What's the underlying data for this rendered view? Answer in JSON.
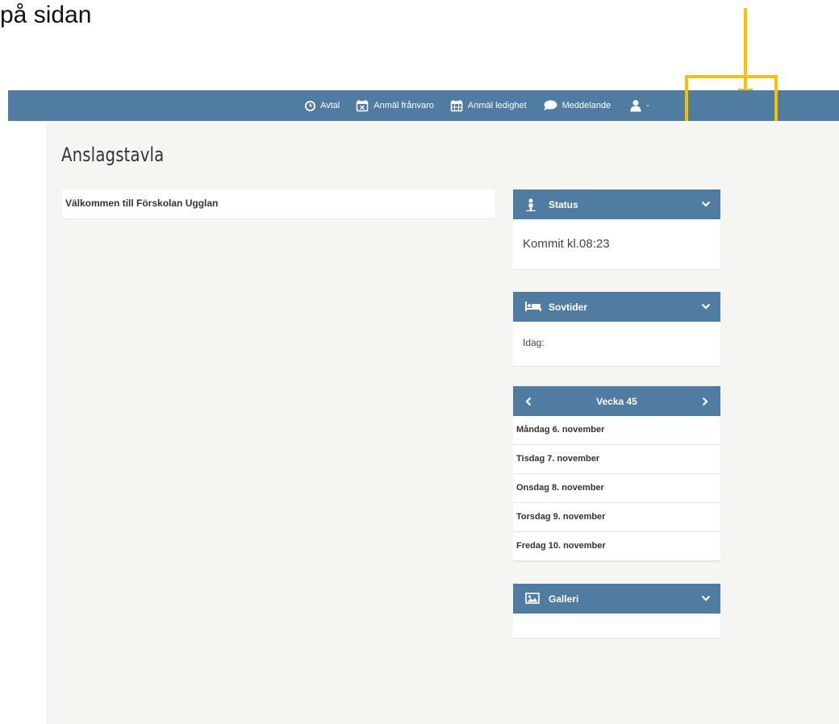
{
  "caption": "på sidan",
  "nav": {
    "items": [
      {
        "label": "Avtal",
        "icon": "clock-icon"
      },
      {
        "label": "Anmäl frånvaro",
        "icon": "calendar-x-icon"
      },
      {
        "label": "Anmäl ledighet",
        "icon": "calendar-icon"
      },
      {
        "label": "Meddelande",
        "icon": "chat-bubble-icon"
      }
    ],
    "user_menu": {
      "icon": "user-icon",
      "caret": "-"
    }
  },
  "page": {
    "title": "Anslagstavla",
    "welcome": "Välkommen till Förskolan Ugglan"
  },
  "widgets": {
    "status": {
      "title": "Status",
      "icon": "child-icon",
      "text": "Kommit kl.08:23"
    },
    "sovtider": {
      "title": "Sovtider",
      "icon": "bed-icon",
      "text": "Idag:"
    },
    "week": {
      "title": "Vecka 45",
      "days": [
        "Måndag 6. november",
        "Tisdag 7. november",
        "Onsdag 8. november",
        "Torsdag 9. november",
        "Fredag 10. november"
      ]
    },
    "galleri": {
      "title": "Galleri",
      "icon": "image-icon"
    }
  },
  "colors": {
    "navbar": "#4f7ca0",
    "content_bg": "#f5f6f2",
    "highlight": "#f5c200"
  }
}
